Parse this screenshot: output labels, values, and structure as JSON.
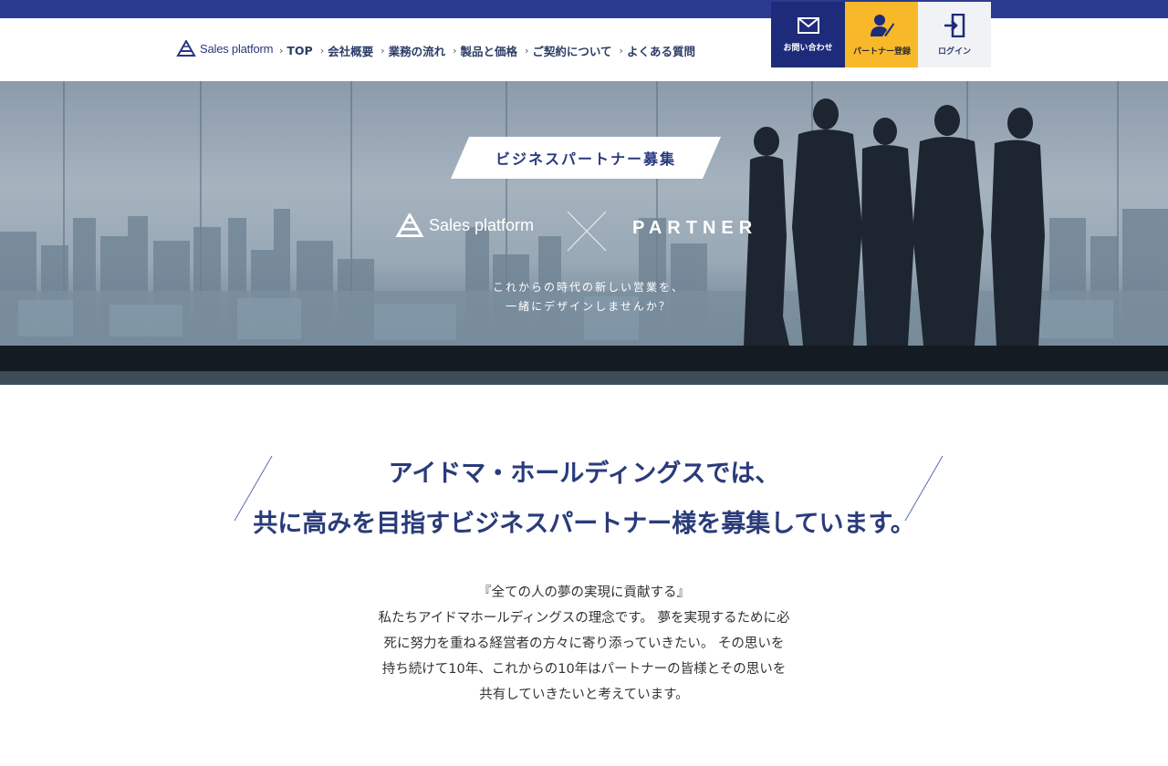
{
  "header": {
    "logo_text": "Sales platform",
    "nav": [
      {
        "label": "TOP"
      },
      {
        "label": "会社概要"
      },
      {
        "label": "業務の流れ"
      },
      {
        "label": "製品と価格"
      },
      {
        "label": "ご契約について"
      },
      {
        "label": "よくある質問"
      }
    ],
    "buttons": {
      "contact": "お問い合わせ",
      "partner": "パートナー登録",
      "login": "ログイン"
    }
  },
  "hero": {
    "banner": "ビジネスパートナー募集",
    "logo_text": "Sales platform",
    "partner": "PARTNER",
    "tagline_line1": "これからの時代の新しい営業を、",
    "tagline_line2": "一緒にデザインしませんか？"
  },
  "main": {
    "headline_line1": "アイドマ・ホールディングスでは、",
    "headline_line2": "共に高みを目指すビジネスパートナー様を募集しています。",
    "body_lines": [
      "『全ての人の夢の実現に貢献する』",
      "私たちアイドマホールディングスの理念です。 夢を実現するために必",
      "死に努力を重ねる経営者の方々に寄り添っていきたい。 その思いを",
      "持ち続けて10年、これからの10年はパートナーの皆様とその思いを",
      "共有していきたいと考えています。"
    ]
  },
  "colors": {
    "brand_navy": "#1e2b7a",
    "accent_yellow": "#f7b82a",
    "headline_blue": "#2a3b7a"
  }
}
